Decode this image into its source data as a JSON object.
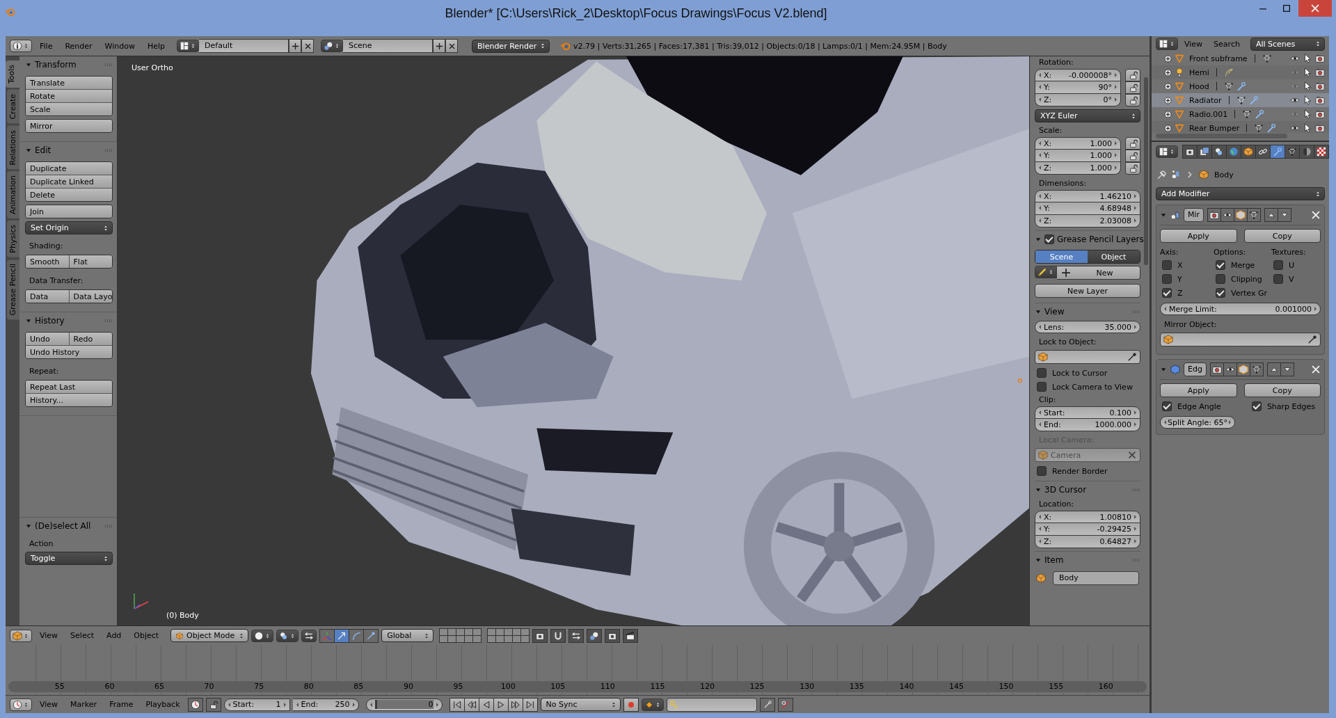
{
  "window": {
    "title": "Blender* [C:\\Users\\Rick_2\\Desktop\\Focus Drawings\\Focus V2.blend]"
  },
  "menubar": {
    "menus": [
      "File",
      "Render",
      "Window",
      "Help"
    ],
    "layout": "Default",
    "scene": "Scene",
    "engine": "Blender Render",
    "stats": "v2.79 | Verts:31,265 | Faces:17,381 | Tris:39,012 | Objects:0/18 | Lamps:0/1 | Mem:24.95M | Body"
  },
  "tool_tabs": [
    {
      "label": "Tools",
      "selected": true
    },
    {
      "label": "Create",
      "selected": false
    },
    {
      "label": "Relations",
      "selected": false
    },
    {
      "label": "Animation",
      "selected": false
    },
    {
      "label": "Physics",
      "selected": false
    },
    {
      "label": "Grease Pencil",
      "selected": false
    }
  ],
  "tool_panels": [
    {
      "title": "Transform",
      "expanded": true,
      "items": [
        {
          "kind": "buttons",
          "rows": [
            [
              "Translate"
            ],
            [
              "Rotate"
            ],
            [
              "Scale"
            ]
          ]
        },
        {
          "kind": "buttons",
          "rows": [
            [
              "Mirror"
            ]
          ]
        }
      ]
    },
    {
      "title": "Edit",
      "expanded": true,
      "items": [
        {
          "kind": "buttons",
          "rows": [
            [
              "Duplicate"
            ],
            [
              "Duplicate Linked"
            ],
            [
              "Delete"
            ]
          ]
        },
        {
          "kind": "buttons",
          "rows": [
            [
              "Join"
            ]
          ]
        },
        {
          "kind": "dropdown",
          "text": "Set Origin"
        },
        {
          "kind": "label",
          "text": "Shading:"
        },
        {
          "kind": "buttons",
          "rows": [
            [
              "Smooth",
              "Flat"
            ]
          ]
        },
        {
          "kind": "label",
          "text": "Data Transfer:"
        },
        {
          "kind": "buttons",
          "rows": [
            [
              "Data",
              "Data Layo"
            ]
          ]
        }
      ]
    },
    {
      "title": "History",
      "expanded": true,
      "items": [
        {
          "kind": "buttons",
          "rows": [
            [
              "Undo",
              "Redo"
            ],
            [
              "Undo History"
            ]
          ]
        },
        {
          "kind": "label",
          "text": "Repeat:"
        },
        {
          "kind": "buttons",
          "rows": [
            [
              "Repeat Last"
            ],
            [
              "History..."
            ]
          ]
        }
      ]
    }
  ],
  "operator_panel": {
    "title": "(De)select All",
    "expanded": true,
    "label": "Action",
    "value": "Toggle"
  },
  "viewport": {
    "view_name": "User Ortho",
    "object_label": "(0) Body"
  },
  "n_panel": {
    "items": [
      {
        "kind": "label",
        "text": "Rotation:",
        "disabled": false
      },
      {
        "kind": "fields",
        "locks": true,
        "fields": [
          {
            "name": "X:",
            "value": "-0.000008°"
          },
          {
            "name": "Y:",
            "value": "90°"
          },
          {
            "name": "Z:",
            "value": "0°"
          }
        ]
      },
      {
        "kind": "dropdown",
        "text": "XYZ Euler"
      },
      {
        "kind": "label",
        "text": "Scale:",
        "disabled": false
      },
      {
        "kind": "fields",
        "locks": true,
        "fields": [
          {
            "name": "X:",
            "value": "1.000"
          },
          {
            "name": "Y:",
            "value": "1.000"
          },
          {
            "name": "Z:",
            "value": "1.000"
          }
        ]
      },
      {
        "kind": "label",
        "text": "Dimensions:",
        "disabled": false
      },
      {
        "kind": "fields",
        "locks": false,
        "fields": [
          {
            "name": "X:",
            "value": "1.46210"
          },
          {
            "name": "Y:",
            "value": "4.68948"
          },
          {
            "name": "Z:",
            "value": "2.03008"
          }
        ]
      },
      {
        "kind": "header",
        "title": "Grease Pencil Layers",
        "expanded": true,
        "checked": true
      },
      {
        "kind": "tabs",
        "tabs": [
          {
            "label": "Scene",
            "selected": true
          },
          {
            "label": "Object",
            "selected": false
          }
        ]
      },
      {
        "kind": "new",
        "text": "New"
      },
      {
        "kind": "button",
        "text": "New Layer"
      },
      {
        "kind": "header",
        "title": "View",
        "expanded": true
      },
      {
        "kind": "fields",
        "locks": false,
        "fields": [
          {
            "name": "Lens:",
            "value": "35.000"
          }
        ]
      },
      {
        "kind": "label",
        "text": "Lock to Object:",
        "disabled": false
      },
      {
        "kind": "object_field",
        "disabled": false
      },
      {
        "kind": "checkbox",
        "text": "Lock to Cursor",
        "checked": false
      },
      {
        "kind": "checkbox",
        "text": "Lock Camera to View",
        "checked": false
      },
      {
        "kind": "label",
        "text": "Clip:",
        "disabled": false
      },
      {
        "kind": "fields",
        "locks": false,
        "fields": [
          {
            "name": "Start:",
            "value": "0.100"
          },
          {
            "name": "End:",
            "value": "1000.000"
          }
        ]
      },
      {
        "kind": "label",
        "text": "Local Camera:",
        "disabled": true
      },
      {
        "kind": "object_field",
        "value": "Camera",
        "disabled": true
      },
      {
        "kind": "checkbox",
        "text": "Render Border",
        "checked": false
      },
      {
        "kind": "header",
        "title": "3D Cursor",
        "expanded": true
      },
      {
        "kind": "label",
        "text": "Location:",
        "disabled": false
      },
      {
        "kind": "fields",
        "locks": false,
        "fields": [
          {
            "name": "X:",
            "value": "1.00810"
          },
          {
            "name": "Y:",
            "value": "-0.29425"
          },
          {
            "name": "Z:",
            "value": "0.64827"
          }
        ]
      },
      {
        "kind": "header",
        "title": "Item",
        "expanded": true
      },
      {
        "kind": "name_field",
        "value": "Body"
      }
    ]
  },
  "outliner": {
    "menus": [
      "View",
      "Search"
    ],
    "filter": "All Scenes",
    "rows": [
      {
        "name": "Front subframe",
        "kind": "mesh",
        "selected": false,
        "visible": true,
        "modifier": false
      },
      {
        "name": "Hemi",
        "kind": "lamp",
        "selected": false,
        "visible": false,
        "modifier": false
      },
      {
        "name": "Hood",
        "kind": "mesh",
        "selected": false,
        "visible": false,
        "modifier": true
      },
      {
        "name": "Radiator",
        "kind": "mesh",
        "selected": true,
        "visible": true,
        "modifier": true
      },
      {
        "name": "Radio.001",
        "kind": "mesh",
        "selected": false,
        "visible": false,
        "modifier": true
      },
      {
        "name": "Rear Bumper",
        "kind": "mesh",
        "selected": false,
        "visible": true,
        "modifier": true
      }
    ]
  },
  "properties": {
    "tabs": [
      {
        "kind": "render",
        "selected": false
      },
      {
        "kind": "layers",
        "selected": false
      },
      {
        "kind": "scene",
        "selected": false
      },
      {
        "kind": "world",
        "selected": false
      },
      {
        "kind": "object",
        "selected": false
      },
      {
        "kind": "constraints",
        "selected": false
      },
      {
        "kind": "modifiers",
        "selected": true
      },
      {
        "kind": "data",
        "selected": false
      },
      {
        "kind": "material",
        "selected": false
      },
      {
        "kind": "texture",
        "selected": false
      }
    ],
    "breadcrumb": "Body",
    "add_modifier": "Add Modifier",
    "modifiers": [
      {
        "kind": "mirror",
        "name": "Mir",
        "expanded": true,
        "apply": "Apply",
        "copy": "Copy",
        "columns": [
          {
            "title": "Axis:",
            "options": [
              {
                "label": "X",
                "checked": false
              },
              {
                "label": "Y",
                "checked": false
              },
              {
                "label": "Z",
                "checked": true
              }
            ]
          },
          {
            "title": "Options:",
            "options": [
              {
                "label": "Merge",
                "checked": true
              },
              {
                "label": "Clipping",
                "checked": false
              },
              {
                "label": "Vertex Gr",
                "checked": true
              }
            ]
          },
          {
            "title": "Textures:",
            "options": [
              {
                "label": "U",
                "checked": false
              },
              {
                "label": "V",
                "checked": false
              }
            ]
          }
        ],
        "field": {
          "label": "Merge Limit:",
          "value": "0.001000"
        },
        "object_label": "Mirror Object:"
      },
      {
        "kind": "edge_split",
        "name": "Edg",
        "expanded": true,
        "apply": "Apply",
        "copy": "Copy",
        "options": [
          {
            "label": "Edge Angle",
            "checked": true
          },
          {
            "label": "Sharp Edges",
            "checked": true
          }
        ],
        "field": {
          "label": "Split Angle:",
          "value": "65°"
        }
      }
    ]
  },
  "viewport_header": {
    "menus": [
      "View",
      "Select",
      "Add",
      "Object"
    ],
    "mode": "Object Mode",
    "orientation": "Global"
  },
  "timeline": {
    "labels": [
      "55",
      "60",
      "65",
      "70",
      "75",
      "80",
      "85",
      "90",
      "95",
      "100",
      "105",
      "110",
      "115",
      "120",
      "125",
      "130",
      "135",
      "140",
      "145",
      "150",
      "155",
      "160"
    ]
  },
  "timeline_header": {
    "menus": [
      "View",
      "Marker",
      "Frame",
      "Playback"
    ],
    "start": {
      "label": "Start:",
      "value": "1"
    },
    "end": {
      "label": "End:",
      "value": "250"
    },
    "current": "0",
    "sync": "No Sync"
  }
}
